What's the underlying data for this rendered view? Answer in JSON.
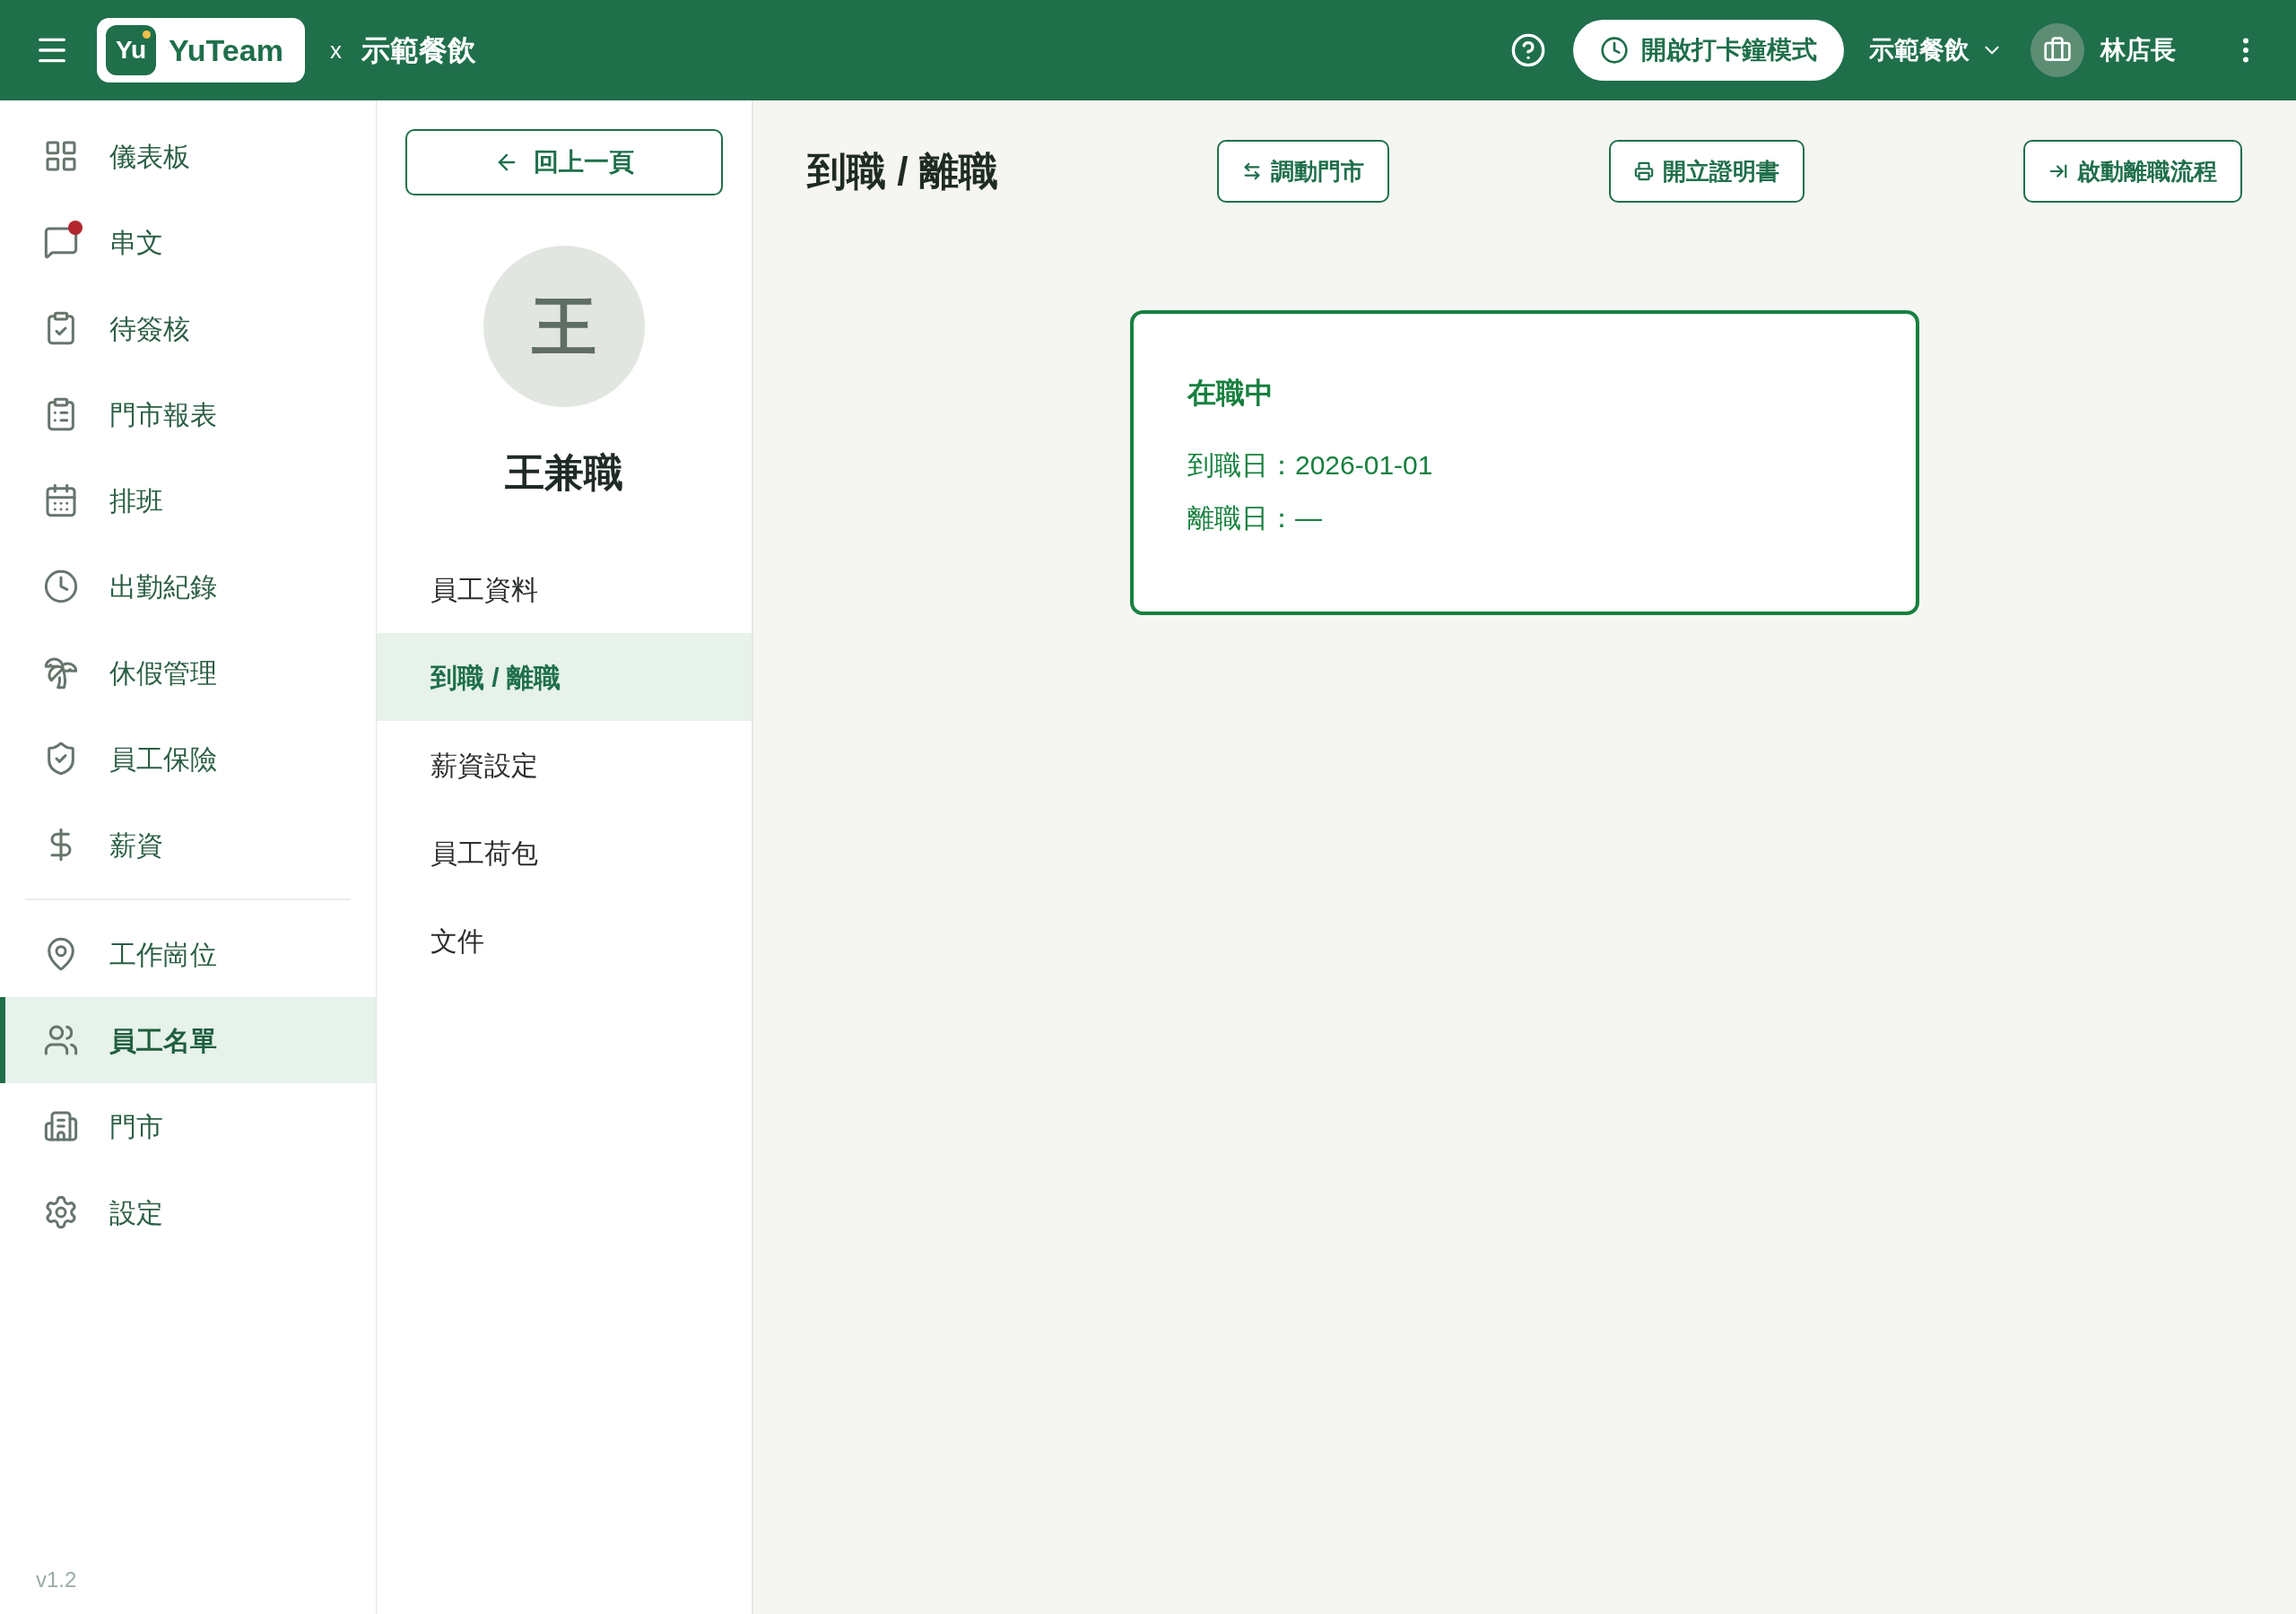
{
  "header": {
    "logo_text": "Yu",
    "brand": "YuTeam",
    "separator": "x",
    "company": "示範餐飲",
    "clock_button": "開啟打卡鐘模式",
    "store_selector": "示範餐飲",
    "user": "林店長"
  },
  "sidebar": {
    "groups": [
      {
        "items": [
          {
            "label": "儀表板",
            "selected": false,
            "badge": false
          },
          {
            "label": "串文",
            "selected": false,
            "badge": true
          },
          {
            "label": "待簽核",
            "selected": false,
            "badge": false
          },
          {
            "label": "門市報表",
            "selected": false,
            "badge": false
          },
          {
            "label": "排班",
            "selected": false,
            "badge": false
          },
          {
            "label": "出勤紀錄",
            "selected": false,
            "badge": false
          },
          {
            "label": "休假管理",
            "selected": false,
            "badge": false
          },
          {
            "label": "員工保險",
            "selected": false,
            "badge": false
          },
          {
            "label": "薪資",
            "selected": false,
            "badge": false
          }
        ]
      },
      {
        "items": [
          {
            "label": "工作崗位",
            "selected": false,
            "badge": false
          },
          {
            "label": "員工名單",
            "selected": true,
            "badge": false
          },
          {
            "label": "門市",
            "selected": false,
            "badge": false
          },
          {
            "label": "設定",
            "selected": false,
            "badge": false
          }
        ]
      }
    ],
    "version": "v1.2"
  },
  "profile": {
    "back_button": "回上一頁",
    "avatar_initial": "王",
    "name": "王兼職",
    "tabs": [
      {
        "label": "員工資料",
        "selected": false
      },
      {
        "label": "到職 / 離職",
        "selected": true
      },
      {
        "label": "薪資設定",
        "selected": false
      },
      {
        "label": "員工荷包",
        "selected": false
      },
      {
        "label": "文件",
        "selected": false
      }
    ]
  },
  "main": {
    "title": "到職 / 離職",
    "actions": [
      "調動門市",
      "開立證明書",
      "啟動離職流程"
    ],
    "status_card": {
      "status": "在職中",
      "lines": [
        "到職日：2026-01-01",
        "離職日：—"
      ]
    }
  }
}
